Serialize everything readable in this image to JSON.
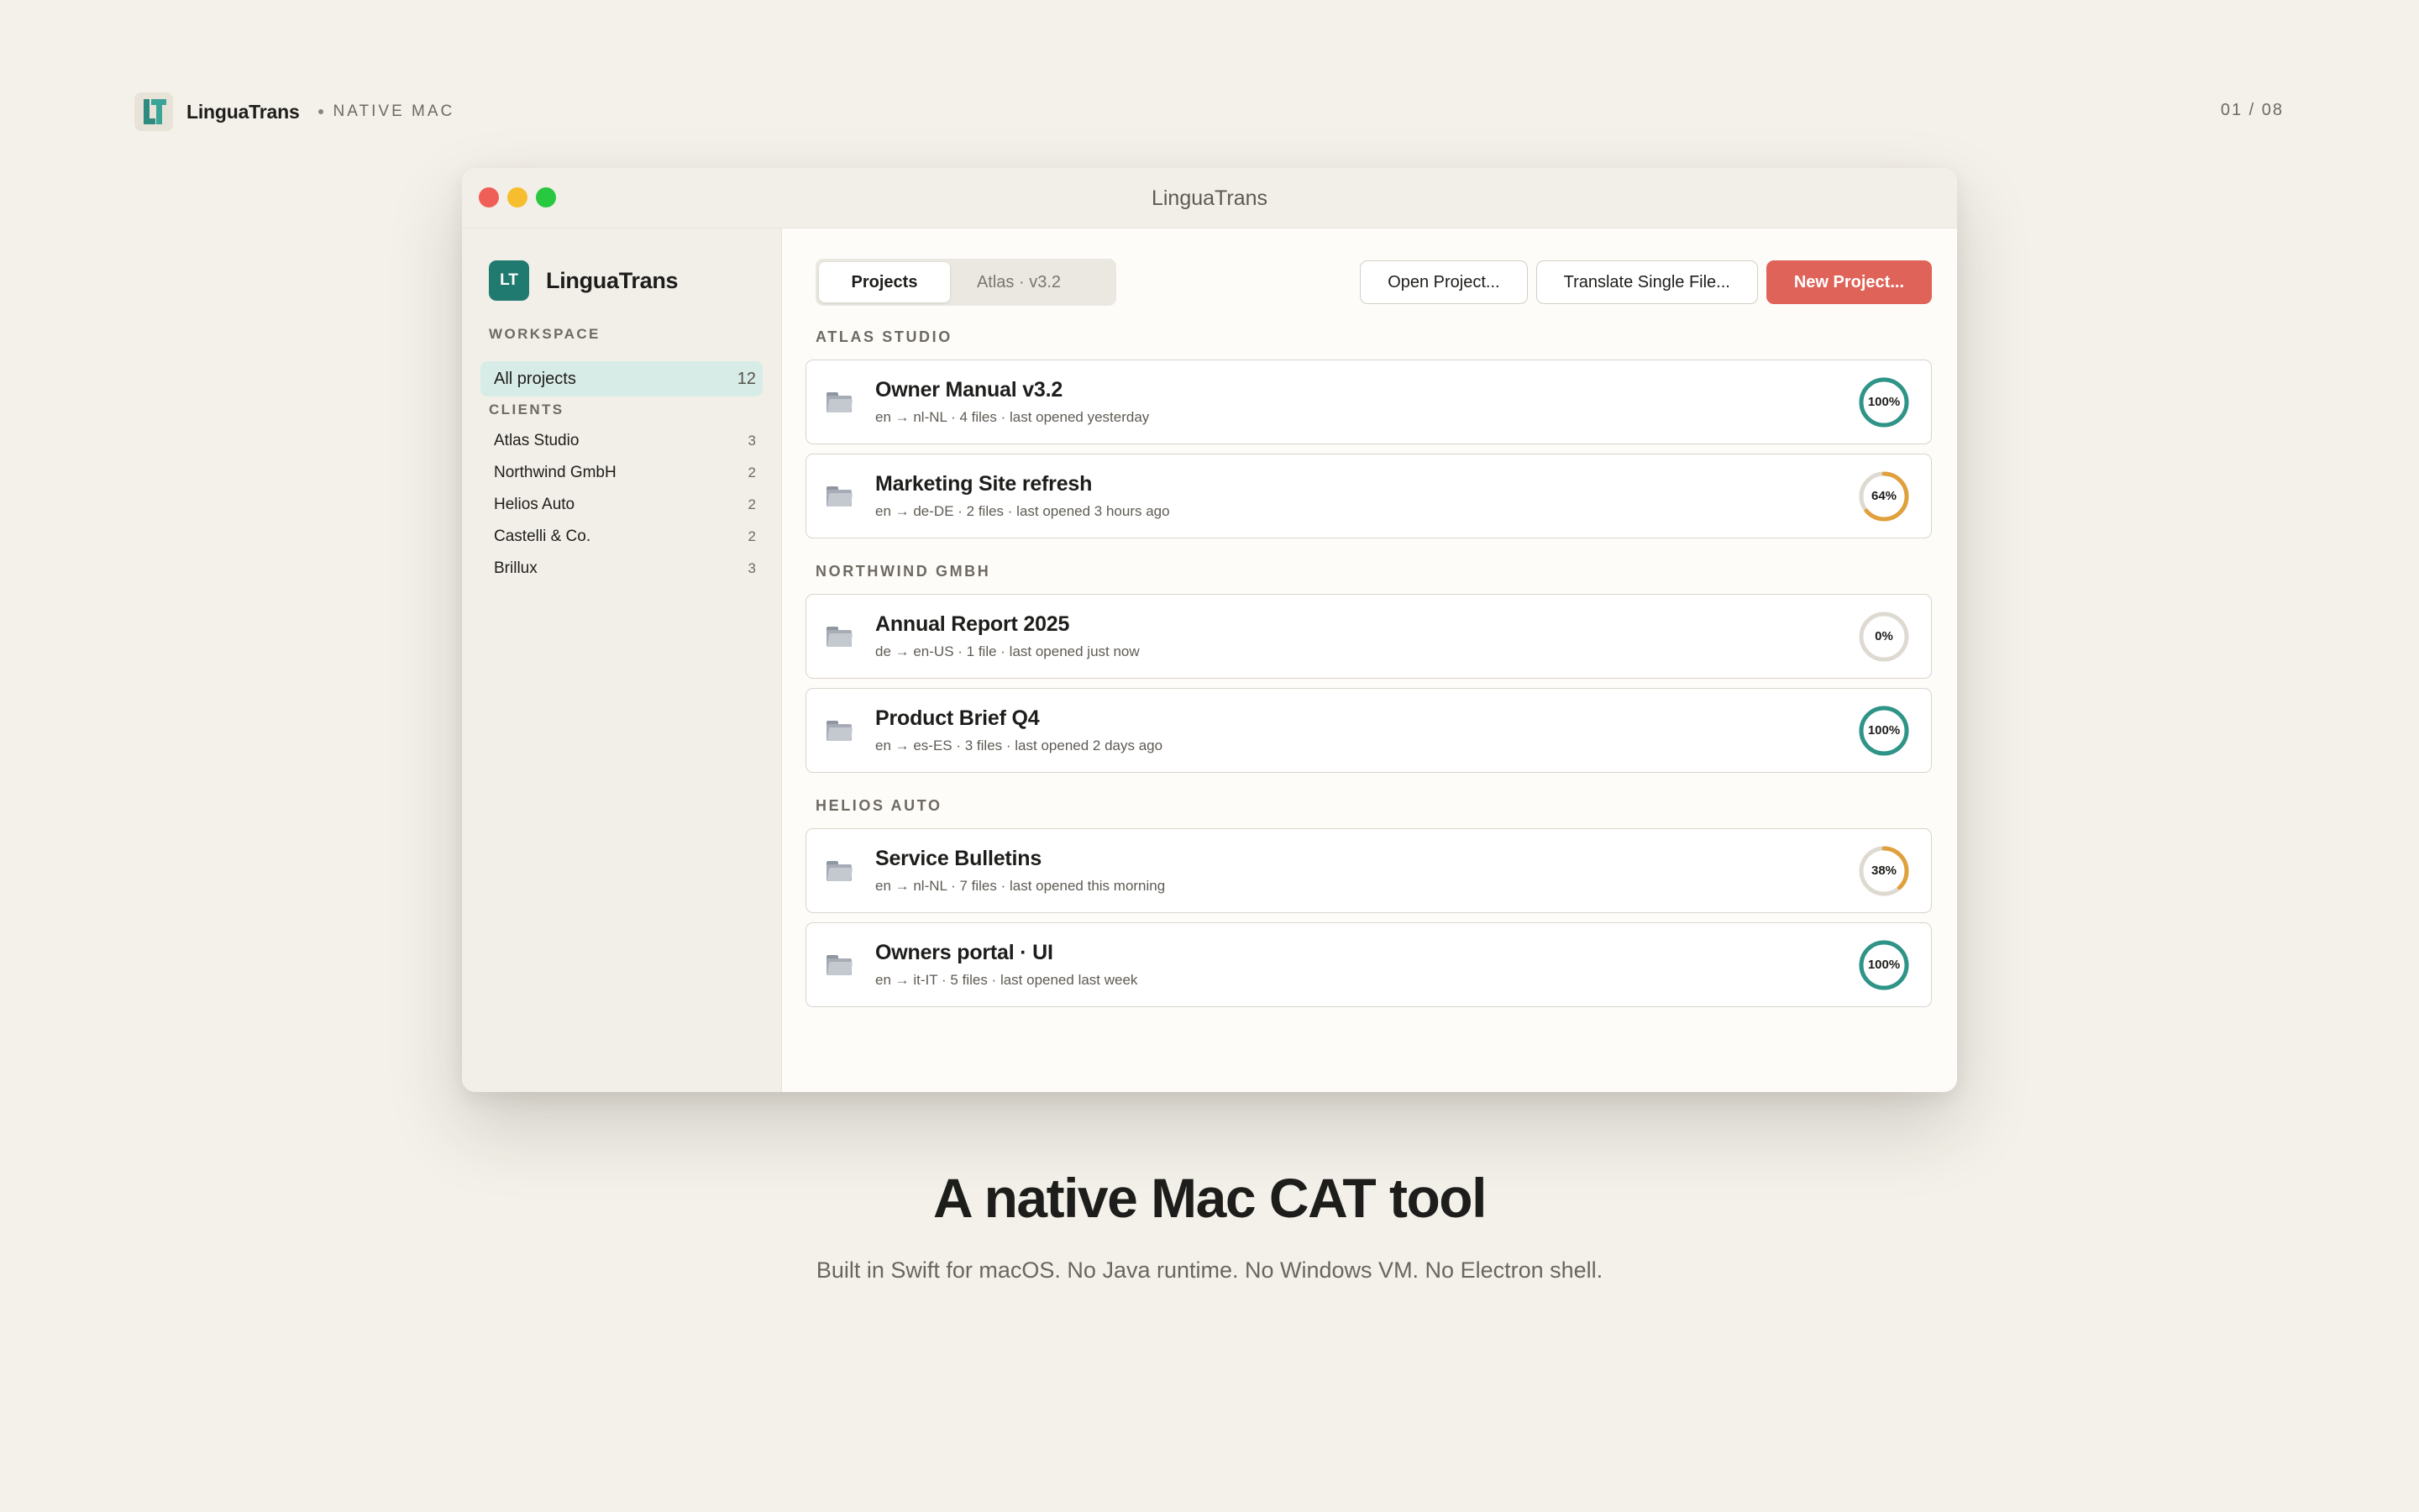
{
  "brand": {
    "name": "LinguaTrans",
    "tag": "NATIVE MAC",
    "counter": "01 / 08"
  },
  "window": {
    "title": "LinguaTrans"
  },
  "sidebar": {
    "badge": "LT",
    "app_name": "LinguaTrans",
    "workspace_label": "WORKSPACE",
    "all_projects": {
      "label": "All projects",
      "count": "12"
    },
    "clients_label": "CLIENTS",
    "clients": [
      {
        "label": "Atlas Studio",
        "count": "3"
      },
      {
        "label": "Northwind GmbH",
        "count": "2"
      },
      {
        "label": "Helios Auto",
        "count": "2"
      },
      {
        "label": "Castelli & Co.",
        "count": "2"
      },
      {
        "label": "Brillux",
        "count": "3"
      }
    ]
  },
  "toolbar": {
    "tabs": [
      {
        "label": "Projects"
      },
      {
        "label": "Atlas · v3.2"
      }
    ],
    "open_label": "Open Project...",
    "translate_label": "Translate Single File...",
    "new_label": "New Project..."
  },
  "groups": [
    {
      "name": "ATLAS STUDIO",
      "projects": [
        {
          "title": "Owner Manual v3.2",
          "meta": "en → nl-NL · 4 files · last opened yesterday",
          "progress_label": "100%",
          "progress": 100
        },
        {
          "title": "Marketing Site refresh",
          "meta": "en → de-DE · 2 files · last opened 3 hours ago",
          "progress_label": "64%",
          "progress": 64
        }
      ]
    },
    {
      "name": "NORTHWIND GMBH",
      "projects": [
        {
          "title": "Annual Report 2025",
          "meta": "de → en-US · 1 file · last opened just now",
          "progress_label": "0%",
          "progress": 0
        },
        {
          "title": "Product Brief Q4",
          "meta": "en → es-ES · 3 files · last opened 2 days ago",
          "progress_label": "100%",
          "progress": 100
        }
      ]
    },
    {
      "name": "HELIOS AUTO",
      "projects": [
        {
          "title": "Service Bulletins",
          "meta": "en → nl-NL · 7 files · last opened this morning",
          "progress_label": "38%",
          "progress": 38
        },
        {
          "title": "Owners portal · UI",
          "meta": "en → it-IT · 5 files · last opened last week",
          "progress_label": "100%",
          "progress": 100
        }
      ]
    }
  ],
  "caption": {
    "headline": "A native Mac CAT tool",
    "subline": "Built in Swift for macOS. No Java runtime. No Windows VM. No Electron shell."
  },
  "colors": {
    "complete": "#2e9488",
    "in_progress": "#e0a03c",
    "track": "#dedad2",
    "accent": "#df6358"
  }
}
